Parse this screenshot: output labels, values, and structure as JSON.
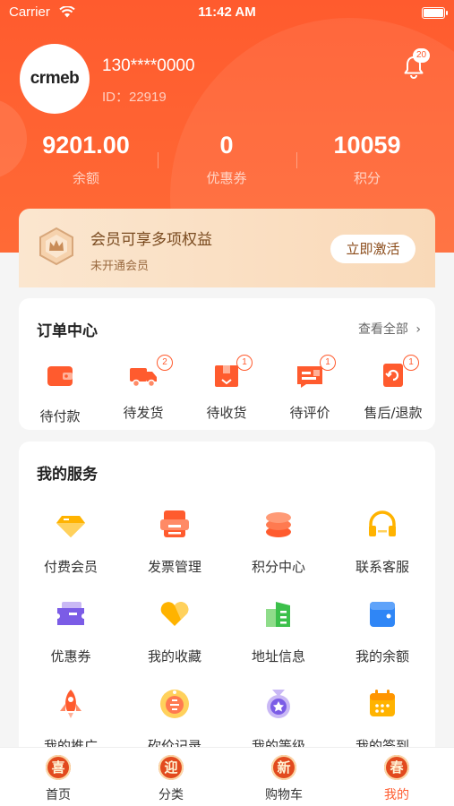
{
  "status_bar": {
    "carrier": "Carrier",
    "time": "11:42 AM"
  },
  "profile": {
    "avatar_text": "crmeb",
    "phone": "130****0000",
    "uid": "ID：22919",
    "notification_count": "20"
  },
  "stats": [
    {
      "value": "9201.00",
      "label": "余额"
    },
    {
      "value": "0",
      "label": "优惠券"
    },
    {
      "value": "10059",
      "label": "积分"
    }
  ],
  "vip": {
    "title": "会员可享多项权益",
    "subtitle": "未开通会员",
    "button": "立即激活"
  },
  "orders": {
    "title": "订单中心",
    "view_all": "查看全部",
    "items": [
      {
        "label": "待付款",
        "badge": "",
        "icon": "wallet-icon"
      },
      {
        "label": "待发货",
        "badge": "2",
        "icon": "delivery-truck-icon"
      },
      {
        "label": "待收货",
        "badge": "1",
        "icon": "package-icon"
      },
      {
        "label": "待评价",
        "badge": "1",
        "icon": "review-icon"
      },
      {
        "label": "售后/退款",
        "badge": "1",
        "icon": "refund-icon"
      }
    ]
  },
  "services": {
    "title": "我的服务",
    "items": [
      {
        "label": "付费会员",
        "icon": "diamond-icon"
      },
      {
        "label": "发票管理",
        "icon": "invoice-icon"
      },
      {
        "label": "积分中心",
        "icon": "points-stack-icon"
      },
      {
        "label": "联系客服",
        "icon": "headset-icon"
      },
      {
        "label": "优惠券",
        "icon": "coupon-icon"
      },
      {
        "label": "我的收藏",
        "icon": "heart-icon"
      },
      {
        "label": "地址信息",
        "icon": "address-icon"
      },
      {
        "label": "我的余额",
        "icon": "balance-wallet-icon"
      },
      {
        "label": "我的推广",
        "icon": "rocket-icon"
      },
      {
        "label": "砍价记录",
        "icon": "bargain-tag-icon"
      },
      {
        "label": "我的等级",
        "icon": "level-medal-icon"
      },
      {
        "label": "我的签到",
        "icon": "calendar-icon"
      }
    ]
  },
  "tabbar": {
    "items": [
      {
        "label": "首页",
        "glyph": "喜"
      },
      {
        "label": "分类",
        "glyph": "迎"
      },
      {
        "label": "购物车",
        "glyph": "新"
      },
      {
        "label": "我的",
        "glyph": "春"
      }
    ],
    "active": "我的"
  },
  "colors": {
    "primary": "#ff5b2e",
    "vip_bg": "#fbe6cf",
    "vip_text": "#7a4b20",
    "page_bg": "#f5f5f5"
  }
}
